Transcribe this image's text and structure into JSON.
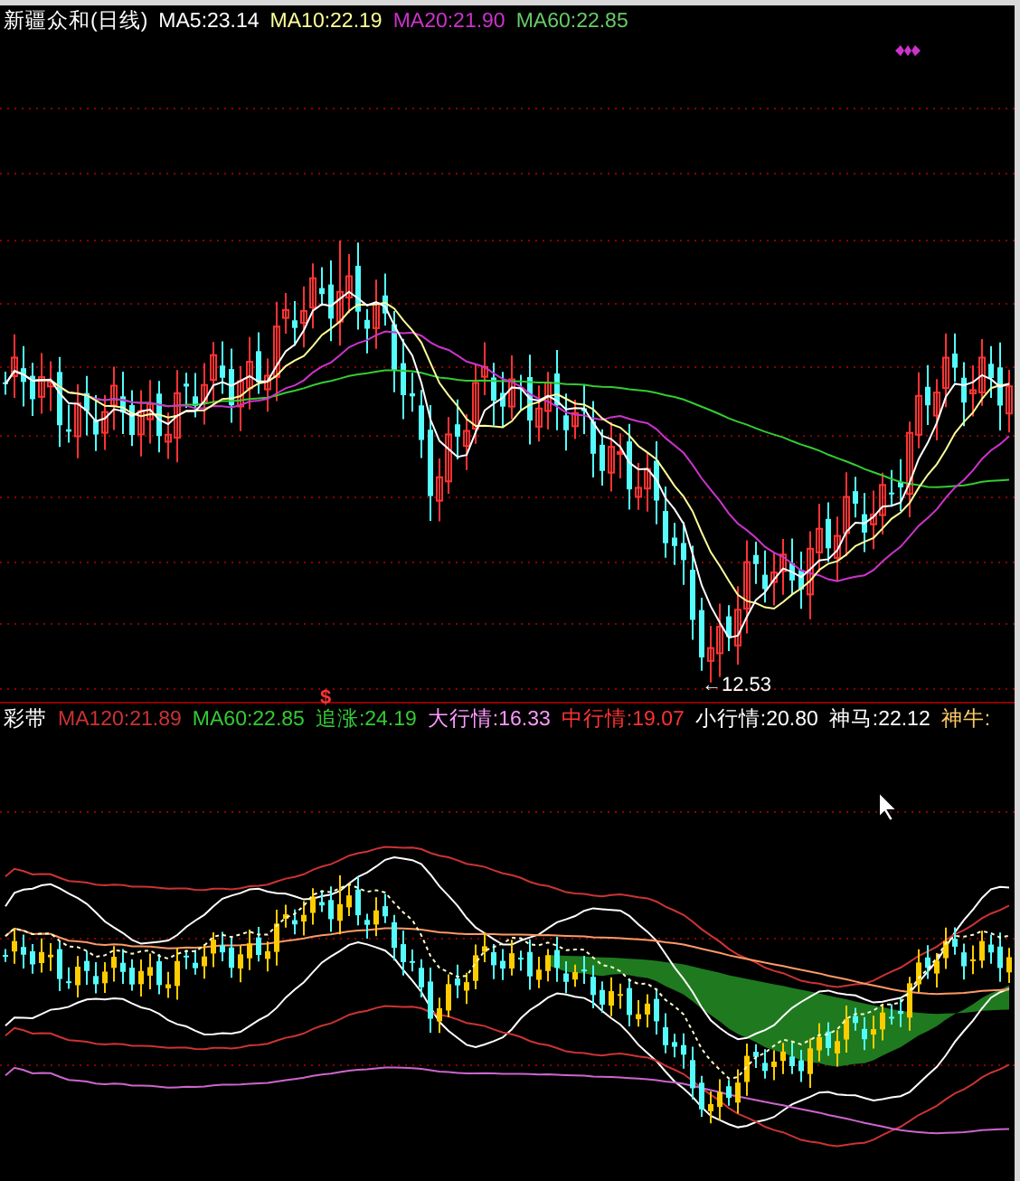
{
  "upper_panel": {
    "title": "新疆众和(日线)",
    "indicators": [
      {
        "label": "MA5:23.14",
        "color": "#ffffff"
      },
      {
        "label": "MA10:22.19",
        "color": "#ffff99"
      },
      {
        "label": "MA20:21.90",
        "color": "#cc33cc"
      },
      {
        "label": "MA60:22.85",
        "color": "#66cc66"
      }
    ],
    "low_label": "←12.53",
    "signal_mark": "$"
  },
  "lower_panel": {
    "title": "彩带",
    "indicators": [
      {
        "label": "MA120:21.89",
        "color": "#cc3333"
      },
      {
        "label": "MA60:22.85",
        "color": "#33cc33"
      },
      {
        "label": "追涨:24.19",
        "color": "#33cc33"
      },
      {
        "label": "大行情:16.33",
        "color": "#ff99ff"
      },
      {
        "label": "中行情:19.07",
        "color": "#ff3333"
      },
      {
        "label": "小行情:20.80",
        "color": "#ffffff"
      },
      {
        "label": "神马:22.12",
        "color": "#ffffff"
      },
      {
        "label": "神牛:",
        "color": "#ffcc66"
      }
    ]
  }
}
